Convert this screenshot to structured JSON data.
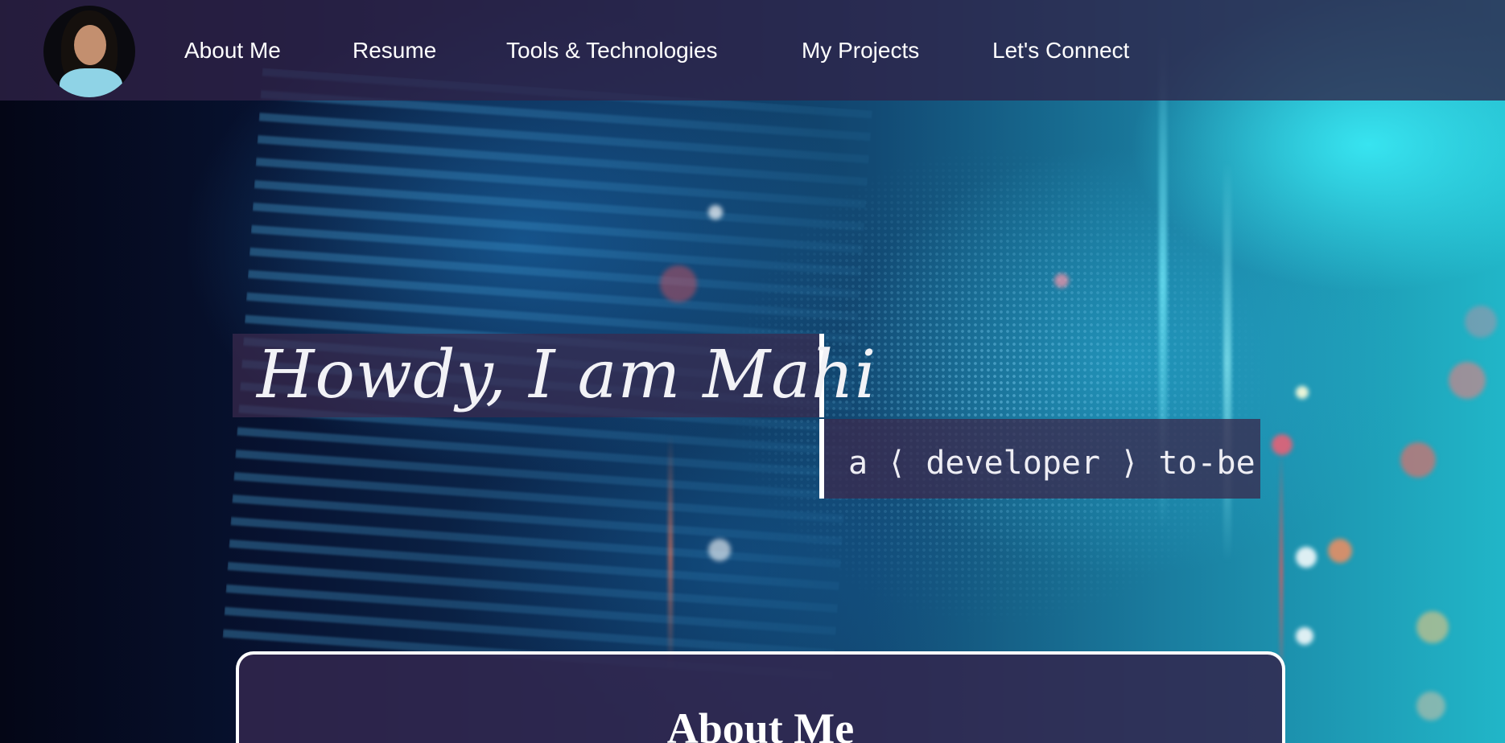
{
  "nav": {
    "avatar_alt": "Profile photo",
    "items": [
      {
        "label": "About Me"
      },
      {
        "label": "Resume"
      },
      {
        "label": "Tools & Technologies"
      },
      {
        "label": "My Projects"
      },
      {
        "label": "Let's Connect"
      }
    ],
    "bar_color": "#30224a"
  },
  "hero": {
    "greeting": "Howdy, I am Mahi",
    "tagline": "a ⟨ developer ⟩ to-be",
    "accent_panel_color": "#3a2a4e"
  },
  "about": {
    "title": "About Me"
  }
}
